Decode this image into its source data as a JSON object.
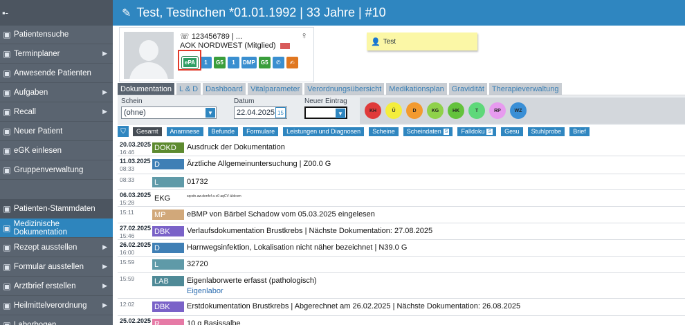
{
  "header": {
    "title": "Test, Testinchen *01.01.1992 | 33 Jahre | #10"
  },
  "sidebar": {
    "items": [
      {
        "label": "Patientensuche",
        "icon": "user-search-icon",
        "arrow": false
      },
      {
        "label": "Terminplaner",
        "icon": "calendar-icon",
        "arrow": true
      },
      {
        "label": "Anwesende Patienten",
        "icon": "people-icon",
        "arrow": false
      },
      {
        "label": "Aufgaben",
        "icon": "task-icon",
        "arrow": true
      },
      {
        "label": "Recall",
        "icon": "recall-icon",
        "arrow": true
      },
      {
        "label": "Neuer Patient",
        "icon": "add-user-icon",
        "arrow": false
      },
      {
        "label": "eGK einlesen",
        "icon": "card-icon",
        "arrow": false
      },
      {
        "label": "Gruppenverwaltung",
        "icon": "group-icon",
        "arrow": false
      },
      {
        "label": "Patienten-Stammdaten",
        "icon": "patient-icon",
        "arrow": false
      },
      {
        "label": "Medizinische Dokumentation",
        "icon": "document-icon",
        "arrow": false
      },
      {
        "label": "Rezept ausstellen",
        "icon": "prescription-icon",
        "arrow": true
      },
      {
        "label": "Formular ausstellen",
        "icon": "form-icon",
        "arrow": true
      },
      {
        "label": "Arztbrief erstellen",
        "icon": "letter-icon",
        "arrow": true
      },
      {
        "label": "Heilmittelverordnung",
        "icon": "remedy-icon",
        "arrow": true
      },
      {
        "label": "Laborbogen",
        "icon": "lab-icon",
        "arrow": false
      }
    ]
  },
  "patient": {
    "phone": "123456789 | ...",
    "insurance": "AOK NORDWEST (Mitglied)",
    "icons": [
      "ePA",
      "1",
      "G5",
      "1",
      "DMP",
      "G5"
    ]
  },
  "note": {
    "text": "Test"
  },
  "tabs": [
    "Dokumentation",
    "L & D",
    "Dashboard",
    "Vitalparameter",
    "Verordnungsübersicht",
    "Medikationsplan",
    "Gravidität",
    "Therapieverwaltung"
  ],
  "filters": {
    "schein_label": "Schein",
    "schein_value": "(ohne)",
    "datum_label": "Datum",
    "datum_value": "22.04.2025",
    "neuer_label": "Neuer Eintrag",
    "circles": [
      {
        "label": "KH",
        "color": "#e03a3a"
      },
      {
        "label": "Ü",
        "color": "#f4ee3c"
      },
      {
        "label": "D",
        "color": "#f39a2e"
      },
      {
        "label": "KG",
        "color": "#8fd14a"
      },
      {
        "label": "HK",
        "color": "#63c23c"
      },
      {
        "label": "T",
        "color": "#5ed87a"
      },
      {
        "label": "RP",
        "color": "#e79bef"
      },
      {
        "label": "WZ",
        "color": "#3a8fd6"
      }
    ]
  },
  "categories": [
    {
      "label": "Gesamt",
      "active": true
    },
    {
      "label": "Anamnese"
    },
    {
      "label": "Befunde"
    },
    {
      "label": "Formulare"
    },
    {
      "label": "Leistungen und Diagnosen"
    },
    {
      "label": "Scheine"
    },
    {
      "label": "Scheindaten",
      "s": "S"
    },
    {
      "label": "Falldoku",
      "s": "S"
    },
    {
      "label": "Gesu"
    },
    {
      "label": "Stuhlprobe"
    },
    {
      "label": "Brief"
    }
  ],
  "entries": [
    {
      "date": "20.03.2025",
      "time": "16:46",
      "badge": "DOKD",
      "color": "#5d8a2f",
      "text": "Ausdruck der Dokumentation"
    },
    {
      "date": "11.03.2025",
      "time": "08:33",
      "badge": "D",
      "color": "#3f7fb5",
      "text": "Ärztliche Allgemeinuntersuchung |  Z00.0 G"
    },
    {
      "date": "",
      "time": "08:33",
      "badge": "L",
      "color": "#5f9aa8",
      "text": "01732"
    },
    {
      "date": "06.03.2025",
      "time": "15:28",
      "badge": "EKG",
      "color": "",
      "text": "sqcdn.aw.denfcf  a-c0  aqCV ä/dcvrn"
    },
    {
      "date": "",
      "time": "15:11",
      "badge": "MP",
      "color": "#d1a87a",
      "text": "eBMP von Bärbel Schadow vom 05.03.2025 eingelesen"
    },
    {
      "date": "27.02.2025",
      "time": "15:46",
      "badge": "DBK",
      "color": "#7a62c8",
      "text": "Verlaufsdokumentation Brustkrebs | Nächste Dokumentation: 27.08.2025"
    },
    {
      "date": "26.02.2025",
      "time": "16:00",
      "badge": "D",
      "color": "#3f7fb5",
      "text": "Harnwegsinfektion, Lokalisation nicht näher bezeichnet |  N39.0 G"
    },
    {
      "date": "",
      "time": "15:59",
      "badge": "L",
      "color": "#5f9aa8",
      "text": "32720"
    },
    {
      "date": "",
      "time": "15:59",
      "badge": "LAB",
      "color": "#4f8a97",
      "text": "Eigenlaborwerte erfasst (pathologisch)",
      "sub": "Eigenlabor"
    },
    {
      "date": "",
      "time": "12:02",
      "badge": "DBK",
      "color": "#7a62c8",
      "text": "Erstdokumentation Brustkrebs | Abgerechnet am 26.02.2025 | Nächste Dokumentation: 26.08.2025"
    },
    {
      "date": "25.02.2025",
      "time": "",
      "badge": "R",
      "color": "#e67aa6",
      "text": "10 g Basissalbe"
    }
  ]
}
